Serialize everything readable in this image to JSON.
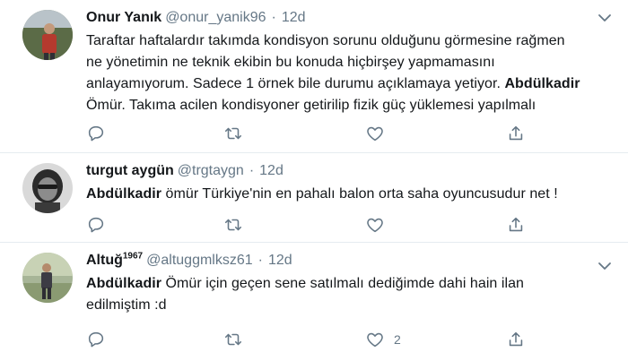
{
  "tweets": [
    {
      "name": "Onur Yanık",
      "name_sup": "",
      "handle": "@onur_yanik96",
      "separator": "·",
      "time": "12d",
      "text_lines": [
        "Taraftar haftalardır takımda kondisyon sorunu olduğunu görmesine rağmen",
        "ne yönetimin ne teknik ekibin bu konuda hiçbirşey yapmamasını",
        "anlayamıyorum. Sadece 1 örnek bile durumu açıklamaya yetiyor. "
      ],
      "text_bold": "Abdülkadir",
      "text_after": "Ömür. Takıma acilen kondisyoner getirilip fizik güç yüklemesi yapılmalı",
      "like_count": ""
    },
    {
      "name": "turgut aygün",
      "name_sup": "",
      "handle": "@trgtaygn",
      "separator": "·",
      "time": "12d",
      "text_bold": "Abdülkadir",
      "text_after": " ömür Türkiye'nin en pahalı balon orta saha oyuncusudur net !",
      "like_count": ""
    },
    {
      "name": "Altuğ",
      "name_sup": "1967",
      "handle": "@altuggmlksz61",
      "separator": "·",
      "time": "12d",
      "text_bold": "Abdülkadir",
      "text_after": " Ömür için geçen sene satılmalı dediğimde dahi hain ilan",
      "text_line2": "edilmiştim :d",
      "like_count": "2"
    }
  ],
  "icons": {
    "reply": "reply-icon",
    "retweet": "retweet-icon",
    "like": "heart-icon",
    "share": "share-icon",
    "more": "chevron-down-icon"
  },
  "colors": {
    "text": "#14171a",
    "secondary": "#657786",
    "border": "#e6ecf0"
  }
}
